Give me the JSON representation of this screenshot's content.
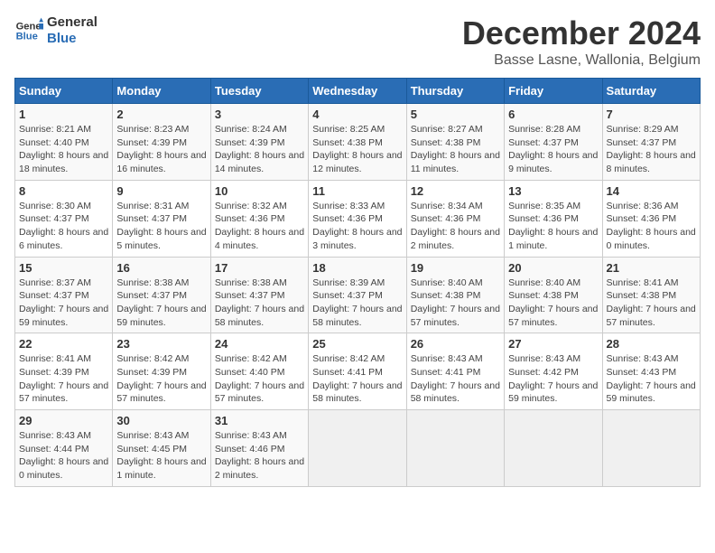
{
  "logo": {
    "line1": "General",
    "line2": "Blue"
  },
  "title": "December 2024",
  "subtitle": "Basse Lasne, Wallonia, Belgium",
  "days_of_week": [
    "Sunday",
    "Monday",
    "Tuesday",
    "Wednesday",
    "Thursday",
    "Friday",
    "Saturday"
  ],
  "weeks": [
    [
      {
        "day": "1",
        "info": "Sunrise: 8:21 AM\nSunset: 4:40 PM\nDaylight: 8 hours and 18 minutes."
      },
      {
        "day": "2",
        "info": "Sunrise: 8:23 AM\nSunset: 4:39 PM\nDaylight: 8 hours and 16 minutes."
      },
      {
        "day": "3",
        "info": "Sunrise: 8:24 AM\nSunset: 4:39 PM\nDaylight: 8 hours and 14 minutes."
      },
      {
        "day": "4",
        "info": "Sunrise: 8:25 AM\nSunset: 4:38 PM\nDaylight: 8 hours and 12 minutes."
      },
      {
        "day": "5",
        "info": "Sunrise: 8:27 AM\nSunset: 4:38 PM\nDaylight: 8 hours and 11 minutes."
      },
      {
        "day": "6",
        "info": "Sunrise: 8:28 AM\nSunset: 4:37 PM\nDaylight: 8 hours and 9 minutes."
      },
      {
        "day": "7",
        "info": "Sunrise: 8:29 AM\nSunset: 4:37 PM\nDaylight: 8 hours and 8 minutes."
      }
    ],
    [
      {
        "day": "8",
        "info": "Sunrise: 8:30 AM\nSunset: 4:37 PM\nDaylight: 8 hours and 6 minutes."
      },
      {
        "day": "9",
        "info": "Sunrise: 8:31 AM\nSunset: 4:37 PM\nDaylight: 8 hours and 5 minutes."
      },
      {
        "day": "10",
        "info": "Sunrise: 8:32 AM\nSunset: 4:36 PM\nDaylight: 8 hours and 4 minutes."
      },
      {
        "day": "11",
        "info": "Sunrise: 8:33 AM\nSunset: 4:36 PM\nDaylight: 8 hours and 3 minutes."
      },
      {
        "day": "12",
        "info": "Sunrise: 8:34 AM\nSunset: 4:36 PM\nDaylight: 8 hours and 2 minutes."
      },
      {
        "day": "13",
        "info": "Sunrise: 8:35 AM\nSunset: 4:36 PM\nDaylight: 8 hours and 1 minute."
      },
      {
        "day": "14",
        "info": "Sunrise: 8:36 AM\nSunset: 4:36 PM\nDaylight: 8 hours and 0 minutes."
      }
    ],
    [
      {
        "day": "15",
        "info": "Sunrise: 8:37 AM\nSunset: 4:37 PM\nDaylight: 7 hours and 59 minutes."
      },
      {
        "day": "16",
        "info": "Sunrise: 8:38 AM\nSunset: 4:37 PM\nDaylight: 7 hours and 59 minutes."
      },
      {
        "day": "17",
        "info": "Sunrise: 8:38 AM\nSunset: 4:37 PM\nDaylight: 7 hours and 58 minutes."
      },
      {
        "day": "18",
        "info": "Sunrise: 8:39 AM\nSunset: 4:37 PM\nDaylight: 7 hours and 58 minutes."
      },
      {
        "day": "19",
        "info": "Sunrise: 8:40 AM\nSunset: 4:38 PM\nDaylight: 7 hours and 57 minutes."
      },
      {
        "day": "20",
        "info": "Sunrise: 8:40 AM\nSunset: 4:38 PM\nDaylight: 7 hours and 57 minutes."
      },
      {
        "day": "21",
        "info": "Sunrise: 8:41 AM\nSunset: 4:38 PM\nDaylight: 7 hours and 57 minutes."
      }
    ],
    [
      {
        "day": "22",
        "info": "Sunrise: 8:41 AM\nSunset: 4:39 PM\nDaylight: 7 hours and 57 minutes."
      },
      {
        "day": "23",
        "info": "Sunrise: 8:42 AM\nSunset: 4:39 PM\nDaylight: 7 hours and 57 minutes."
      },
      {
        "day": "24",
        "info": "Sunrise: 8:42 AM\nSunset: 4:40 PM\nDaylight: 7 hours and 57 minutes."
      },
      {
        "day": "25",
        "info": "Sunrise: 8:42 AM\nSunset: 4:41 PM\nDaylight: 7 hours and 58 minutes."
      },
      {
        "day": "26",
        "info": "Sunrise: 8:43 AM\nSunset: 4:41 PM\nDaylight: 7 hours and 58 minutes."
      },
      {
        "day": "27",
        "info": "Sunrise: 8:43 AM\nSunset: 4:42 PM\nDaylight: 7 hours and 59 minutes."
      },
      {
        "day": "28",
        "info": "Sunrise: 8:43 AM\nSunset: 4:43 PM\nDaylight: 7 hours and 59 minutes."
      }
    ],
    [
      {
        "day": "29",
        "info": "Sunrise: 8:43 AM\nSunset: 4:44 PM\nDaylight: 8 hours and 0 minutes."
      },
      {
        "day": "30",
        "info": "Sunrise: 8:43 AM\nSunset: 4:45 PM\nDaylight: 8 hours and 1 minute."
      },
      {
        "day": "31",
        "info": "Sunrise: 8:43 AM\nSunset: 4:46 PM\nDaylight: 8 hours and 2 minutes."
      },
      {
        "day": "",
        "info": "",
        "empty": true
      },
      {
        "day": "",
        "info": "",
        "empty": true
      },
      {
        "day": "",
        "info": "",
        "empty": true
      },
      {
        "day": "",
        "info": "",
        "empty": true
      }
    ]
  ]
}
